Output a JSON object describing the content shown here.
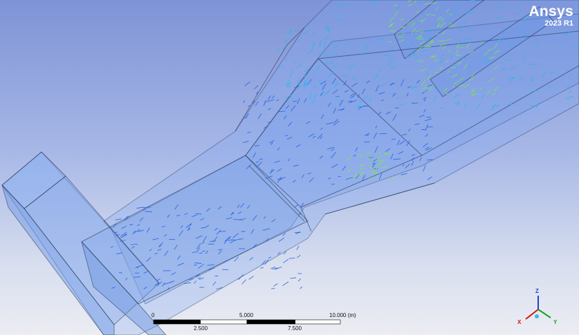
{
  "brand": {
    "name": "Ansys",
    "version": "2023 R1"
  },
  "scale_bar": {
    "top_labels": [
      "0",
      "5.000",
      "10.000 (m)"
    ],
    "bottom_labels": [
      "2.500",
      "7.500"
    ]
  },
  "triad": {
    "axes": [
      {
        "label": "Z",
        "color": "#1f3fcf"
      },
      {
        "label": "X",
        "color": "#d01818"
      },
      {
        "label": "Y",
        "color": "#18a020"
      }
    ]
  },
  "colors": {
    "vector_low": "#1f5fe0",
    "vector_mid": "#27b8e8",
    "vector_high": "#7fe84a"
  }
}
